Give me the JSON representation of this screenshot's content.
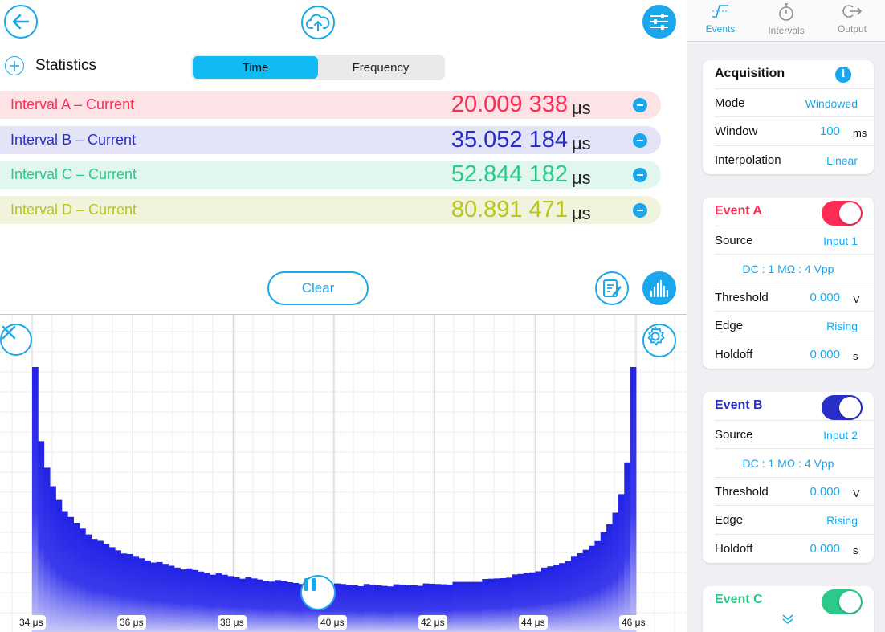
{
  "toolbar": {
    "back_icon": "arrow-left-icon",
    "upload_icon": "cloud-upload-icon",
    "settings_icon": "sliders-icon"
  },
  "statistics": {
    "title": "Statistics",
    "segment": {
      "options": [
        "Time",
        "Frequency"
      ],
      "selected": "Time"
    },
    "intervals": [
      {
        "label": "Interval A – Current",
        "value": "20.009 338",
        "unit": "μs",
        "color": "#FF2D55",
        "bg": "#FDE2E6"
      },
      {
        "label": "Interval B – Current",
        "value": "35.052 184",
        "unit": "μs",
        "color": "#2A2EC9",
        "bg": "#E3E4F8"
      },
      {
        "label": "Interval C – Current",
        "value": "52.844 182",
        "unit": "μs",
        "color": "#2DC98A",
        "bg": "#E1F6EE"
      },
      {
        "label": "Interval D – Current",
        "value": "80.891 471",
        "unit": "μs",
        "color": "#B8C51E",
        "bg": "#F1F3DC"
      }
    ],
    "clear_label": "Clear"
  },
  "chart_data": {
    "type": "bar",
    "description_free": true,
    "xlim": [
      34,
      46
    ],
    "x_ticks": [
      "34 μs",
      "36 μs",
      "38 μs",
      "40 μs",
      "42 μs",
      "44 μs",
      "46 μs"
    ],
    "shape": "u-shaped histogram",
    "bin_heights_relative": [
      1.0,
      0.72,
      0.62,
      0.55,
      0.5,
      0.46,
      0.43,
      0.41,
      0.39,
      0.37,
      0.355,
      0.34,
      0.33,
      0.32,
      0.31,
      0.3,
      0.29,
      0.285,
      0.278,
      0.272,
      0.266,
      0.26,
      0.255,
      0.25,
      0.245,
      0.24,
      0.236,
      0.232,
      0.228,
      0.224,
      0.22,
      0.217,
      0.214,
      0.211,
      0.208,
      0.205,
      0.203,
      0.2,
      0.198,
      0.196,
      0.194,
      0.192,
      0.19,
      0.188,
      0.187,
      0.185,
      0.184,
      0.183,
      0.182,
      0.181,
      0.18,
      0.179,
      0.179,
      0.178,
      0.178,
      0.177,
      0.177,
      0.177,
      0.176,
      0.176,
      0.176,
      0.176,
      0.177,
      0.177,
      0.178,
      0.178,
      0.179,
      0.18,
      0.181,
      0.182,
      0.183,
      0.185,
      0.187,
      0.189,
      0.191,
      0.193,
      0.196,
      0.199,
      0.202,
      0.205,
      0.209,
      0.213,
      0.217,
      0.222,
      0.227,
      0.233,
      0.239,
      0.246,
      0.254,
      0.262,
      0.272,
      0.283,
      0.295,
      0.31,
      0.327,
      0.347,
      0.373,
      0.405,
      0.45,
      0.52,
      0.64,
      1.02
    ],
    "color": "#2020E0"
  },
  "sidebar": {
    "tabs": [
      {
        "label": "Events",
        "icon": "step-signal-icon",
        "active": true
      },
      {
        "label": "Intervals",
        "icon": "stopwatch-icon",
        "active": false
      },
      {
        "label": "Output",
        "icon": "logout-icon",
        "active": false
      }
    ],
    "acquisition": {
      "title": "Acquisition",
      "mode_label": "Mode",
      "mode_value": "Windowed",
      "window_label": "Window",
      "window_value": "100",
      "window_unit": "ms",
      "interp_label": "Interpolation",
      "interp_value": "Linear"
    },
    "event_a": {
      "title": "Event A",
      "color": "#FF2D55",
      "source_label": "Source",
      "source_value": "Input 1",
      "coupling": "DC : 1 MΩ : 4 Vpp",
      "threshold_label": "Threshold",
      "threshold_value": "0.000",
      "threshold_unit": "V",
      "edge_label": "Edge",
      "edge_value": "Rising",
      "holdoff_label": "Holdoff",
      "holdoff_value": "0.000",
      "holdoff_unit": "s"
    },
    "event_b": {
      "title": "Event B",
      "color": "#2A2EC9",
      "source_label": "Source",
      "source_value": "Input 2",
      "coupling": "DC : 1 MΩ : 4 Vpp",
      "threshold_label": "Threshold",
      "threshold_value": "0.000",
      "threshold_unit": "V",
      "edge_label": "Edge",
      "edge_value": "Rising",
      "holdoff_label": "Holdoff",
      "holdoff_value": "0.000",
      "holdoff_unit": "s"
    },
    "event_c": {
      "title": "Event C",
      "color": "#2DC98A"
    }
  }
}
